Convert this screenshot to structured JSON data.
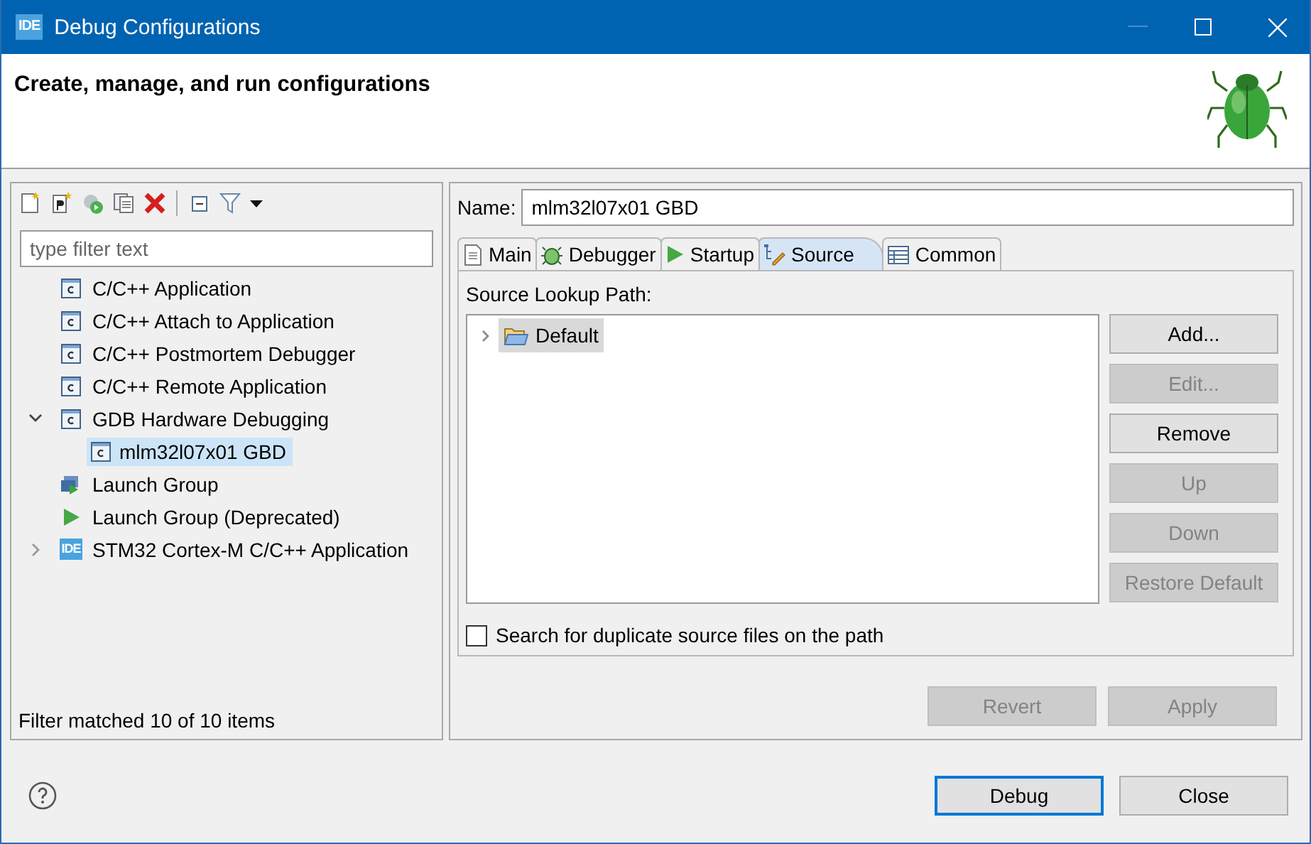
{
  "window": {
    "app_icon": "IDE",
    "title": "Debug Configurations"
  },
  "header": {
    "title": "Create, manage, and run configurations"
  },
  "filter": {
    "placeholder": "type filter text"
  },
  "tree": [
    {
      "label": "C/C++ Application",
      "kind": "c",
      "selected": false
    },
    {
      "label": "C/C++ Attach to Application",
      "kind": "c",
      "selected": false
    },
    {
      "label": "C/C++ Postmortem Debugger",
      "kind": "c",
      "selected": false
    },
    {
      "label": "C/C++ Remote Application",
      "kind": "c",
      "selected": false
    },
    {
      "label": "GDB Hardware Debugging",
      "kind": "c",
      "expanded": true,
      "selected": false,
      "children": [
        {
          "label": "mlm32l07x01 GBD",
          "kind": "c",
          "selected": true
        }
      ]
    },
    {
      "label": "Launch Group",
      "kind": "group",
      "selected": false
    },
    {
      "label": "Launch Group (Deprecated)",
      "kind": "play",
      "selected": false
    },
    {
      "label": "STM32 Cortex-M C/C++ Application",
      "kind": "ide",
      "icon_text": "IDE",
      "expanded": false,
      "selected": false
    }
  ],
  "filter_status": "Filter matched 10 of 10 items",
  "name": {
    "label": "Name:",
    "value": "mlm32l07x01 GBD"
  },
  "tabs": [
    {
      "label": "Main",
      "kind": "page",
      "selected": false
    },
    {
      "label": "Debugger",
      "kind": "bug",
      "selected": false
    },
    {
      "label": "Startup",
      "kind": "play",
      "selected": false
    },
    {
      "label": "Source",
      "kind": "source",
      "selected": true
    },
    {
      "label": "Common",
      "kind": "table",
      "selected": false
    }
  ],
  "source": {
    "label": "Source Lookup Path:",
    "entries": [
      {
        "label": "Default",
        "expanded": false,
        "selected": true
      }
    ]
  },
  "side_buttons": [
    {
      "label": "Add...",
      "disabled": false
    },
    {
      "label": "Edit...",
      "disabled": true
    },
    {
      "label": "Remove",
      "disabled": false
    },
    {
      "label": "Up",
      "disabled": true
    },
    {
      "label": "Down",
      "disabled": true
    },
    {
      "label": "Restore Default",
      "disabled": true
    }
  ],
  "duplicate_check": {
    "label": "Search for duplicate source files on the path",
    "checked": false
  },
  "apply_buttons": [
    {
      "label": "Revert",
      "disabled": true
    },
    {
      "label": "Apply",
      "disabled": true
    }
  ],
  "dialog_buttons": [
    {
      "label": "Debug",
      "default": true
    },
    {
      "label": "Close",
      "default": false
    }
  ]
}
